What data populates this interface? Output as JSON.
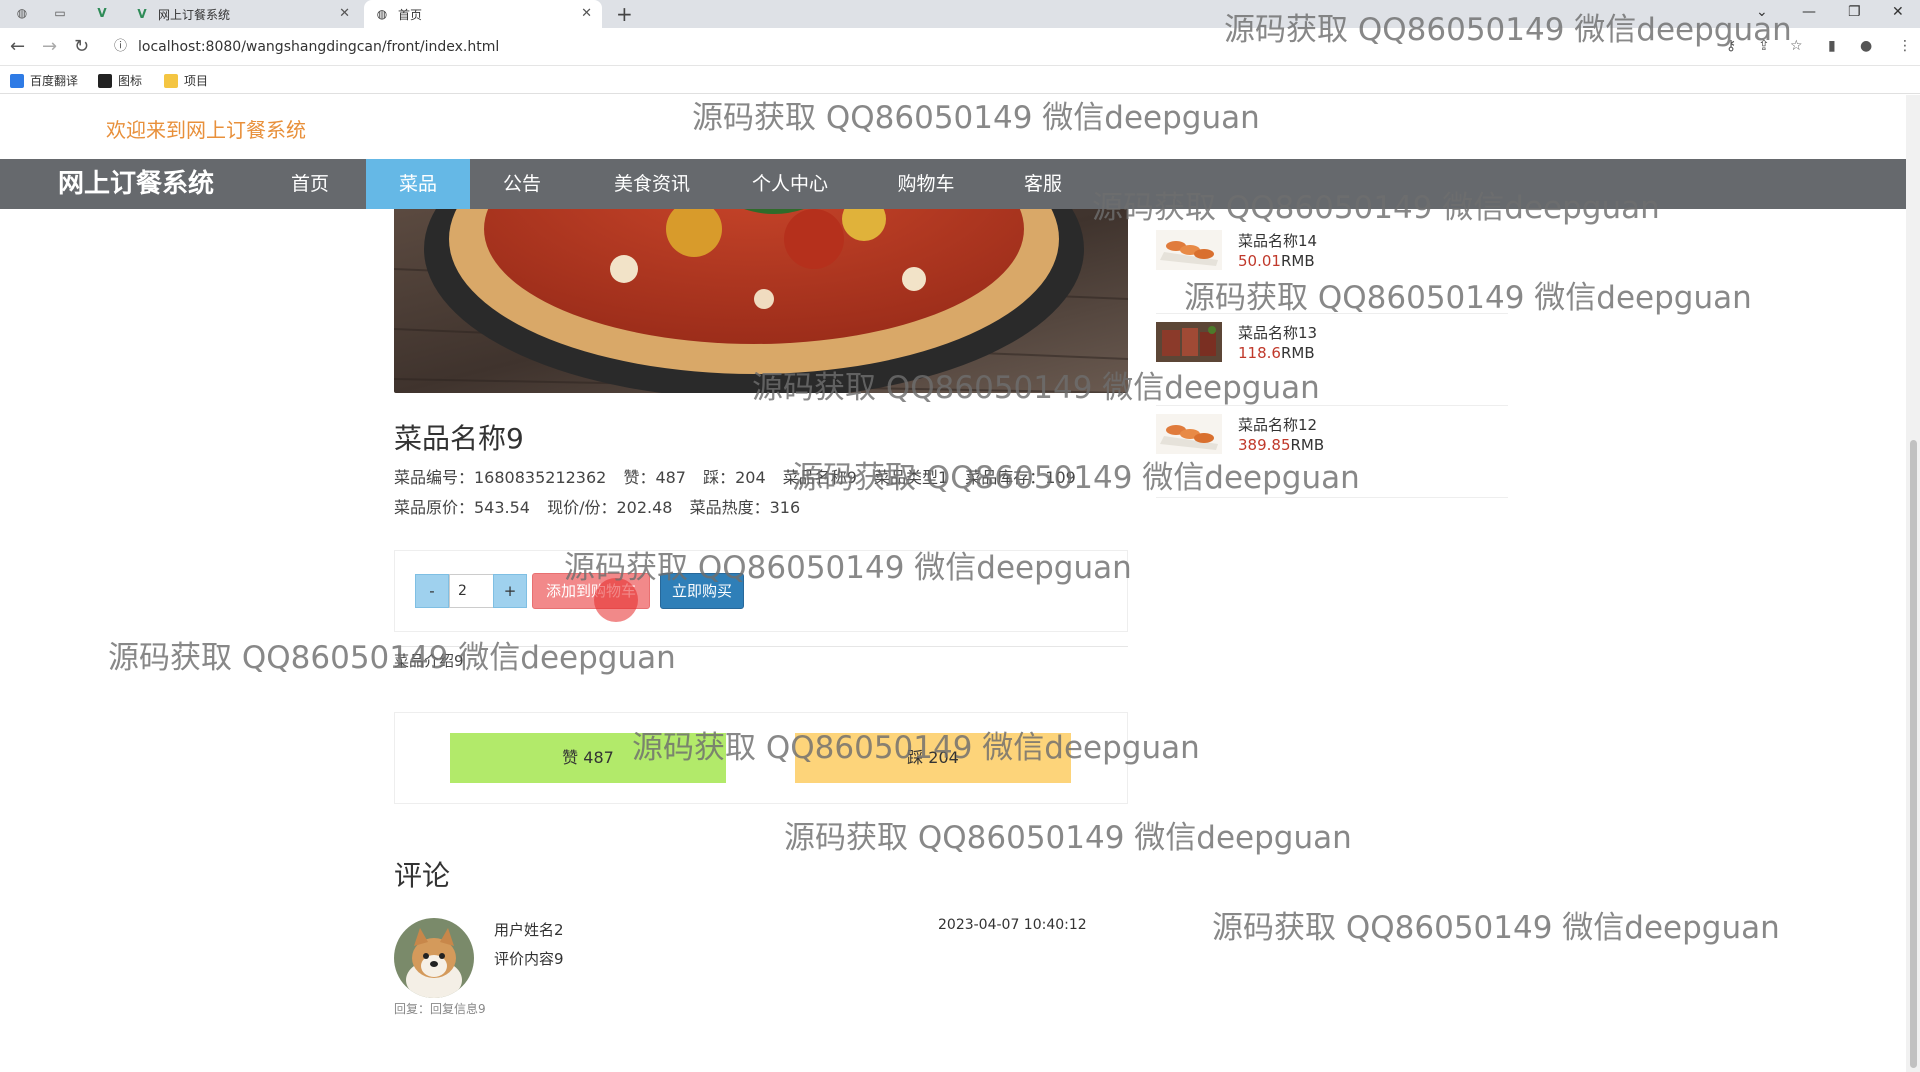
{
  "browser": {
    "tabs": [
      {
        "title": "网上订餐系统",
        "active": false
      },
      {
        "title": "首页",
        "active": true
      }
    ],
    "url": "localhost:8080/wangshangdingcan/front/index.html",
    "bookmarks": [
      "百度翻译",
      "图标",
      "项目"
    ]
  },
  "header": {
    "welcome": "欢迎来到网上订餐系统",
    "brand": "网上订餐系统",
    "nav": [
      {
        "label": "首页",
        "active": false
      },
      {
        "label": "菜品",
        "active": true
      },
      {
        "label": "公告",
        "active": false
      },
      {
        "label": "美食资讯",
        "active": false
      },
      {
        "label": "个人中心",
        "active": false
      },
      {
        "label": "购物车",
        "active": false
      },
      {
        "label": "客服",
        "active": false
      }
    ]
  },
  "dish": {
    "name": "菜品名称9",
    "meta_line1": [
      "菜品编号：1680835212362",
      "赞：487",
      "踩：204",
      "菜品名称9",
      "菜品类型1",
      "菜品库存：109"
    ],
    "meta_line2": [
      "菜品原价：543.54",
      "现价/份：202.48",
      "菜品热度：316"
    ],
    "quantity": "2",
    "minus_label": "-",
    "plus_label": "+",
    "add_to_cart": "添加到购物车",
    "buy_now": "立即购买",
    "intro_label": "菜品介绍9",
    "like_label": "赞  487",
    "dislike_label": "踩  204"
  },
  "comments": {
    "title": "评论",
    "items": [
      {
        "user": "用户姓名2",
        "content": "评价内容9",
        "time": "2023-04-07 10:40:12",
        "reply": "回复：回复信息9"
      }
    ]
  },
  "sidebar": {
    "items": [
      {
        "name": "菜品名称14",
        "price": "50.01",
        "unit": "RMB"
      },
      {
        "name": "菜品名称13",
        "price": "118.6",
        "unit": "RMB"
      },
      {
        "name": "菜品名称12",
        "price": "389.85",
        "unit": "RMB"
      }
    ]
  },
  "watermark": "源码获取 QQ86050149 微信deepguan",
  "colors": {
    "welcome": "#e8903b",
    "nav_bg": "#66696d",
    "nav_active": "#65b8e6",
    "like": "#b2ea6a",
    "dislike": "#fdd47a",
    "cart_btn": "#f2898a",
    "buy_btn": "#2f7fb8",
    "price": "#c0392b"
  }
}
